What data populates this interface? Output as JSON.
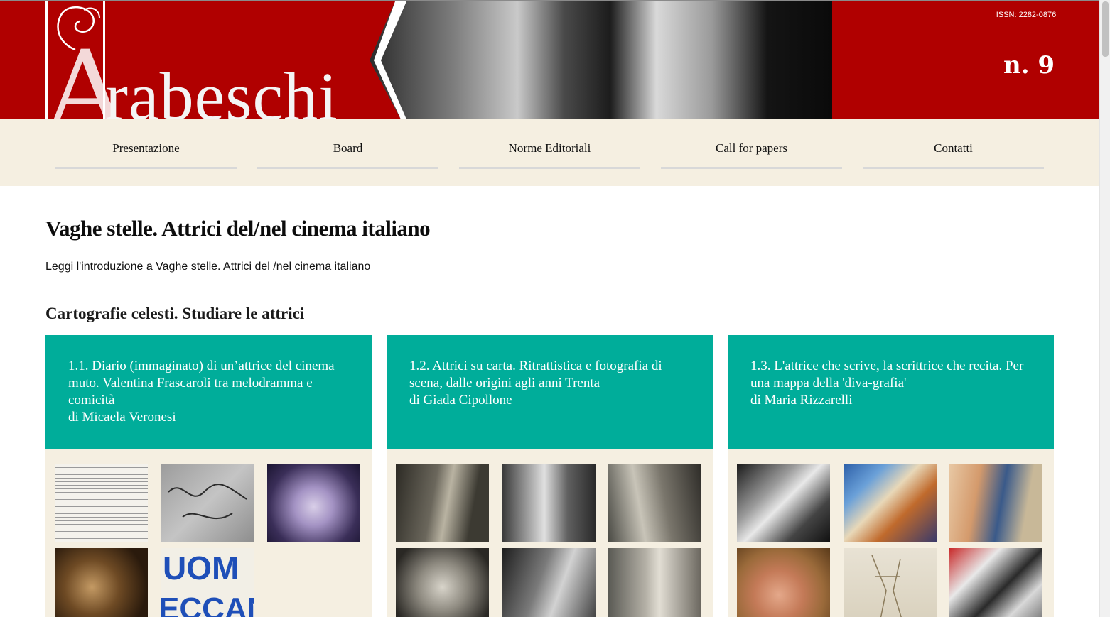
{
  "header": {
    "logo_text": "Arabeschi",
    "issn": "ISSN: 2282-0876",
    "issue": "n. 9"
  },
  "nav": {
    "items": [
      {
        "label": "Presentazione"
      },
      {
        "label": "Board"
      },
      {
        "label": "Norme Editoriali"
      },
      {
        "label": "Call for papers"
      },
      {
        "label": "Contatti"
      }
    ]
  },
  "main": {
    "title": "Vaghe stelle. Attrici del/nel cinema italiano",
    "intro_link": "Leggi l'introduzione a Vaghe stelle. Attrici del /nel cinema italiano",
    "section_title": "Cartografie celesti. Studiare le attrici",
    "cards": [
      {
        "title": "1.1. Diario (immaginato) di un’attrice del cinema muto. Valentina Frascaroli tra melodramma e comicità",
        "author": "di Micaela Veronesi"
      },
      {
        "title": "1.2. Attrici su carta. Ritrattistica e fotografia di scena, dalle origini agli anni Trenta",
        "author": "di Giada Cipollone"
      },
      {
        "title": "1.3. L'attrice che scrive, la scrittrice che recita. Per una mappa della 'diva-grafia'",
        "author": "di Maria Rizzarelli"
      }
    ]
  },
  "colors": {
    "header_red": "#b00000",
    "nav_cream": "#f5efe1",
    "card_teal": "#00ad9a"
  }
}
